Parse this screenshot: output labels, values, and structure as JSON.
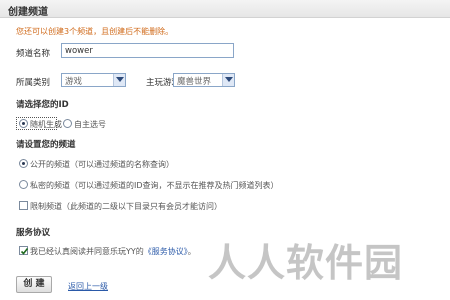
{
  "page": {
    "title": "创建频道"
  },
  "notice": "您还可以创建3个频道，且创建后不能删除。",
  "form": {
    "channel_name_label": "频道名称",
    "channel_name_value": "wower",
    "category_label": "所属类别",
    "category_value": "游戏",
    "theme_game_label": "主玩游戏",
    "theme_game_value": "魔兽世界"
  },
  "id_section": {
    "title": "请选择您的ID",
    "options": [
      {
        "label": "随机生成",
        "checked": true
      },
      {
        "label": "自主选号",
        "checked": false
      }
    ]
  },
  "channel_type_section": {
    "title": "请设置您的频道",
    "public": {
      "label": "公开的频道",
      "desc": "（可以通过频道的名称查询）",
      "checked": true
    },
    "private": {
      "label": "私密的频道",
      "desc": "（可以通过频道的ID查询，不显示在推荐及热门频道列表）",
      "checked": false
    },
    "restricted": {
      "label": "限制频道",
      "desc": "（此频道的二级以下目录只有会员才能访问）",
      "checked": false
    }
  },
  "agreement_section": {
    "title": "服务协议",
    "text_before": "我已经认真阅读并同意乐玩YY的",
    "link": "《服务协议》",
    "text_after": "。",
    "checked": true
  },
  "actions": {
    "create_label": "创 建",
    "back_link": "返回上一级"
  },
  "watermark": "人人软件园"
}
